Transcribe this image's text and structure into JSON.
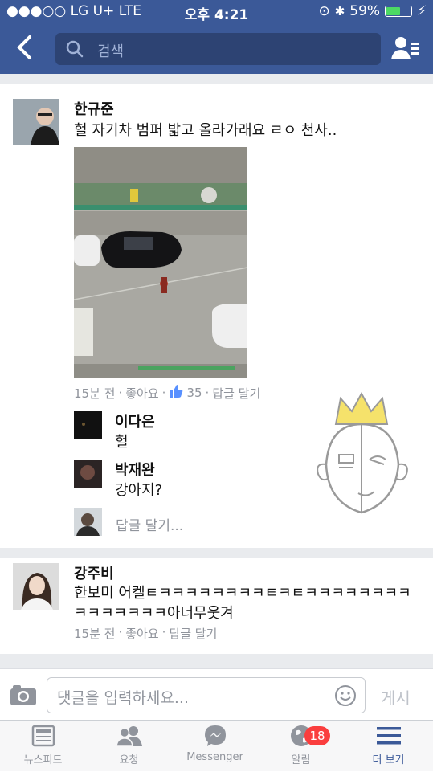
{
  "status_bar": {
    "carrier": "●●●○○ LG U+  LTE",
    "time": "오후 4:21",
    "battery_percent": "59%",
    "battery_level": 0.59
  },
  "nav": {
    "search_placeholder": "검색"
  },
  "post1": {
    "author": "한규준",
    "text": "헐 자기차 범퍼 밟고 올라가래요 ㄹㅇ 천사..",
    "meta": {
      "time": "15분 전",
      "like": "좋아요",
      "like_count": "35",
      "reply": "답글 달기"
    },
    "replies": [
      {
        "name": "이다은",
        "text": "헐"
      },
      {
        "name": "박재완",
        "text": "강아지?"
      }
    ],
    "reply_placeholder": "답글 달기..."
  },
  "post2": {
    "author": "강주비",
    "text_line1": "한보미 어켈ㅌㅋㅋㅋㅋㅋㅋㅋㅋㅌㅋㅌㅋㅋㅋㅋㅋㅋㅋㅋ",
    "text_line2": "ㅋㅋㅋㅋㅋㅋㅋ아너무웃겨",
    "meta": {
      "time": "15분 전",
      "like": "좋아요",
      "reply": "답글 달기"
    }
  },
  "composer": {
    "placeholder": "댓글을 입력하세요...",
    "post_label": "게시"
  },
  "tabs": [
    {
      "label": "뉴스피드",
      "icon": "news-feed-icon"
    },
    {
      "label": "요청",
      "icon": "friend-requests-icon"
    },
    {
      "label": "Messenger",
      "icon": "messenger-icon"
    },
    {
      "label": "알림",
      "icon": "notifications-globe-icon",
      "badge": "18"
    },
    {
      "label": "더 보기",
      "icon": "more-menu-icon",
      "active": true
    }
  ],
  "colors": {
    "brand": "#3b5998",
    "badge": "#fa3e3e",
    "meta": "#90949c"
  }
}
